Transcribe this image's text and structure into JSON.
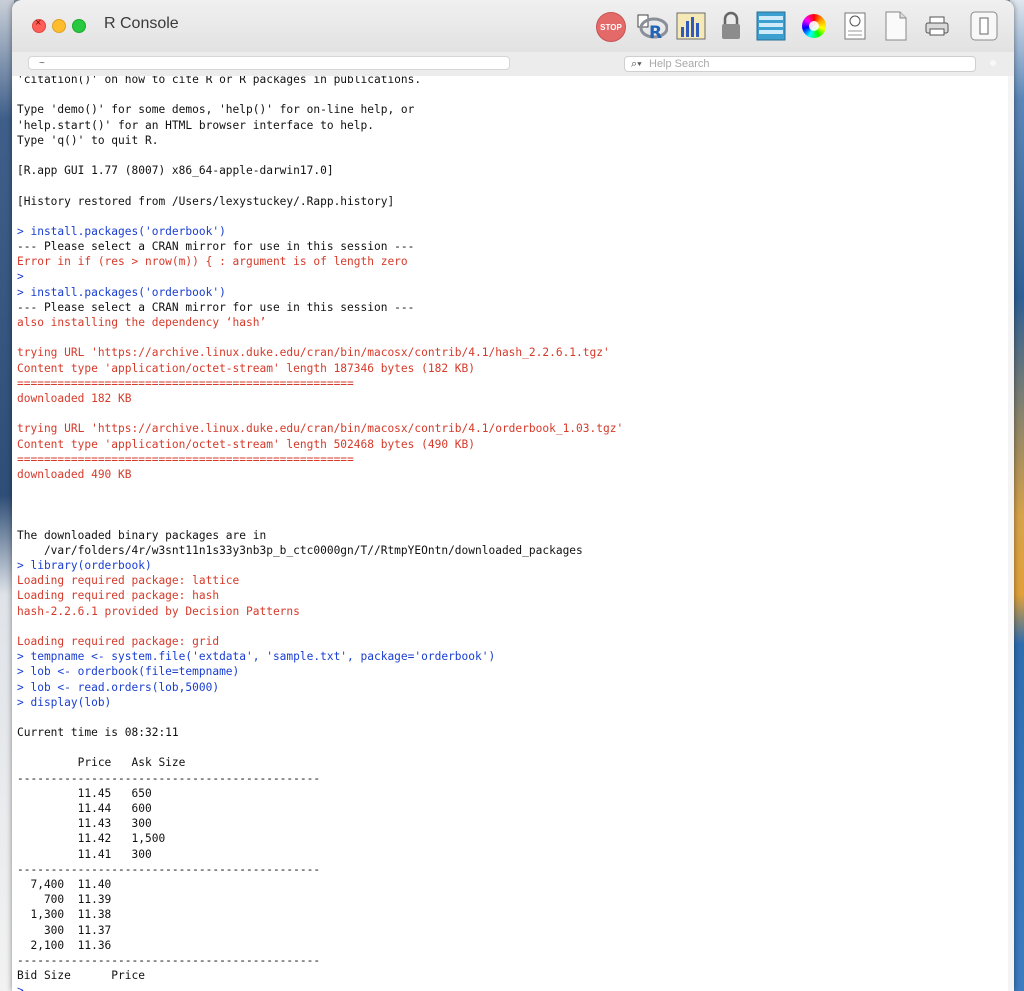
{
  "window": {
    "title": "R Console",
    "working_dir": "~",
    "search_placeholder": "Help Search",
    "stop_label": "STOP"
  },
  "colors": {
    "command": "#1a3ed1",
    "error": "#d63a2a",
    "output": "#111111"
  },
  "toolbar": {
    "icons": [
      "stop-icon",
      "r-logo-icon",
      "chart-icon",
      "lock-icon",
      "list-icon",
      "color-wheel-icon",
      "document-icon",
      "blank-document-icon",
      "printer-icon",
      "sidebar-toggle-icon"
    ]
  },
  "console": {
    "lines": [
      {
        "t": "out",
        "s": "'citation()' on how to cite R or R packages in publications."
      },
      {
        "t": "out",
        "s": ""
      },
      {
        "t": "out",
        "s": "Type 'demo()' for some demos, 'help()' for on-line help, or"
      },
      {
        "t": "out",
        "s": "'help.start()' for an HTML browser interface to help."
      },
      {
        "t": "out",
        "s": "Type 'q()' to quit R."
      },
      {
        "t": "out",
        "s": ""
      },
      {
        "t": "out",
        "s": "[R.app GUI 1.77 (8007) x86_64-apple-darwin17.0]"
      },
      {
        "t": "out",
        "s": ""
      },
      {
        "t": "out",
        "s": "[History restored from /Users/lexystuckey/.Rapp.history]"
      },
      {
        "t": "out",
        "s": ""
      },
      {
        "t": "cmd",
        "s": "> install.packages('orderbook')"
      },
      {
        "t": "out",
        "s": "--- Please select a CRAN mirror for use in this session ---"
      },
      {
        "t": "err",
        "s": "Error in if (res > nrow(m)) { : argument is of length zero"
      },
      {
        "t": "cmd",
        "s": ">"
      },
      {
        "t": "cmd",
        "s": "> install.packages('orderbook')"
      },
      {
        "t": "out",
        "s": "--- Please select a CRAN mirror for use in this session ---"
      },
      {
        "t": "err",
        "s": "also installing the dependency ‘hash’"
      },
      {
        "t": "out",
        "s": ""
      },
      {
        "t": "err",
        "s": "trying URL 'https://archive.linux.duke.edu/cran/bin/macosx/contrib/4.1/hash_2.2.6.1.tgz'"
      },
      {
        "t": "err",
        "s": "Content type 'application/octet-stream' length 187346 bytes (182 KB)"
      },
      {
        "t": "err",
        "s": "=================================================="
      },
      {
        "t": "err",
        "s": "downloaded 182 KB"
      },
      {
        "t": "out",
        "s": ""
      },
      {
        "t": "err",
        "s": "trying URL 'https://archive.linux.duke.edu/cran/bin/macosx/contrib/4.1/orderbook_1.03.tgz'"
      },
      {
        "t": "err",
        "s": "Content type 'application/octet-stream' length 502468 bytes (490 KB)"
      },
      {
        "t": "err",
        "s": "=================================================="
      },
      {
        "t": "err",
        "s": "downloaded 490 KB"
      },
      {
        "t": "out",
        "s": ""
      },
      {
        "t": "out",
        "s": ""
      },
      {
        "t": "out",
        "s": ""
      },
      {
        "t": "out",
        "s": "The downloaded binary packages are in"
      },
      {
        "t": "out",
        "s": "\t/var/folders/4r/w3snt11n1s33y3nb3p_b_ctc0000gn/T//RtmpYEOntn/downloaded_packages"
      },
      {
        "t": "cmd",
        "s": "> library(orderbook)"
      },
      {
        "t": "err",
        "s": "Loading required package: lattice"
      },
      {
        "t": "err",
        "s": "Loading required package: hash"
      },
      {
        "t": "err",
        "s": "hash-2.2.6.1 provided by Decision Patterns"
      },
      {
        "t": "out",
        "s": ""
      },
      {
        "t": "err",
        "s": "Loading required package: grid"
      },
      {
        "t": "cmd",
        "s": "> tempname <- system.file('extdata', 'sample.txt', package='orderbook')"
      },
      {
        "t": "cmd",
        "s": "> lob <- orderbook(file=tempname)"
      },
      {
        "t": "cmd",
        "s": "> lob <- read.orders(lob,5000)"
      },
      {
        "t": "cmd",
        "s": "> display(lob)"
      },
      {
        "t": "out",
        "s": ""
      },
      {
        "t": "out",
        "s": "Current time is 08:32:11"
      },
      {
        "t": "out",
        "s": ""
      },
      {
        "t": "out",
        "s": "         Price   Ask Size"
      },
      {
        "t": "out",
        "s": "---------------------------------------------"
      },
      {
        "t": "out",
        "s": "         11.45   650"
      },
      {
        "t": "out",
        "s": "         11.44   600"
      },
      {
        "t": "out",
        "s": "         11.43   300"
      },
      {
        "t": "out",
        "s": "         11.42   1,500"
      },
      {
        "t": "out",
        "s": "         11.41   300"
      },
      {
        "t": "out",
        "s": "---------------------------------------------"
      },
      {
        "t": "out",
        "s": "  7,400  11.40"
      },
      {
        "t": "out",
        "s": "    700  11.39"
      },
      {
        "t": "out",
        "s": "  1,300  11.38"
      },
      {
        "t": "out",
        "s": "    300  11.37"
      },
      {
        "t": "out",
        "s": "  2,100  11.36"
      },
      {
        "t": "out",
        "s": "---------------------------------------------"
      },
      {
        "t": "out",
        "s": "Bid Size      Price"
      },
      {
        "t": "cmd",
        "s": ">"
      }
    ]
  }
}
